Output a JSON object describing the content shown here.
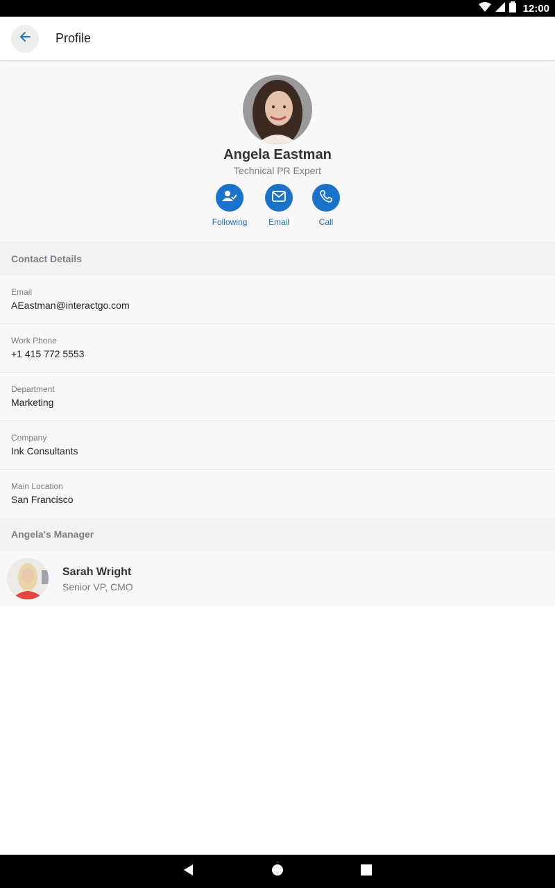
{
  "status_bar": {
    "time": "12:00"
  },
  "app_bar": {
    "title": "Profile"
  },
  "profile": {
    "name": "Angela Eastman",
    "title": "Technical PR Expert",
    "actions": {
      "following": "Following",
      "email": "Email",
      "call": "Call"
    }
  },
  "contact_details": {
    "header": "Contact Details",
    "fields": [
      {
        "label": "Email",
        "value": "AEastman@interactgo.com"
      },
      {
        "label": "Work Phone",
        "value": "+1 415 772 5553"
      },
      {
        "label": "Department",
        "value": "Marketing"
      },
      {
        "label": "Company",
        "value": "Ink Consultants"
      },
      {
        "label": "Main Location",
        "value": "San Francisco"
      }
    ]
  },
  "manager": {
    "header": "Angela's Manager",
    "name": "Sarah Wright",
    "title": "Senior VP, CMO"
  },
  "colors": {
    "accent": "#1a73c8",
    "section_header_text": "#7b7f87"
  },
  "icons": {
    "back": "arrow-left-icon",
    "following": "user-check-icon",
    "email": "envelope-icon",
    "call": "phone-icon",
    "nav_back": "triangle-back-icon",
    "nav_home": "circle-home-icon",
    "nav_recent": "square-recent-icon"
  }
}
